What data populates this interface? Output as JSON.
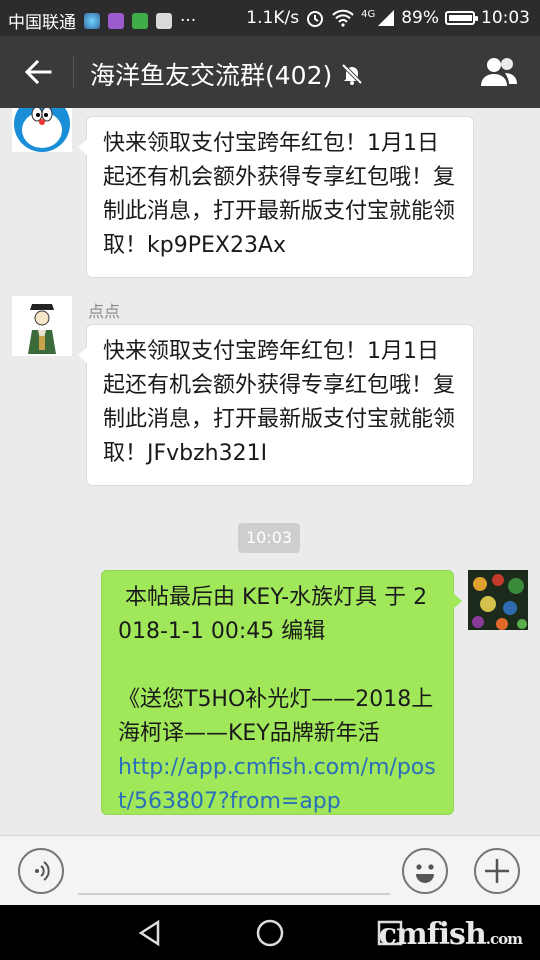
{
  "status_bar": {
    "carrier": "中国联通",
    "dots": "···",
    "net_speed": "1.1K/s",
    "net_type": "4G",
    "battery_pct": "89%",
    "battery_level": 0.89,
    "time": "10:03"
  },
  "header": {
    "title": "海洋鱼友交流群(402)",
    "icons": {
      "back": "back-arrow-icon",
      "mute": "bell-muted-icon",
      "group": "group-members-icon"
    }
  },
  "messages": [
    {
      "side": "left",
      "sender": "",
      "avatar": "doraemon-avatar",
      "text": "快来领取支付宝跨年红包！1月1日起还有机会额外获得专享红包哦！复制此消息，打开最新版支付宝就能领取！kp9PEX23Ax"
    },
    {
      "side": "left",
      "sender": "点点",
      "avatar": "scholar-avatar",
      "text": "快来领取支付宝跨年红包！1月1日起还有机会额外获得专享红包哦！复制此消息，打开最新版支付宝就能领取！JFvbzh321I"
    }
  ],
  "time_divider": "10:03",
  "my_message": {
    "avatar": "aquarium-avatar",
    "line1": " 本帖最后由 KEY-水族灯具 于 2018-1-1 00:45 编辑",
    "line2": "《送您T5HO补光灯——2018上海柯译——KEY品牌新年活",
    "link": "http://app.cmfish.com/m/post/563807?from=app"
  },
  "input_bar": {
    "icons": {
      "voice": "voice-icon",
      "emoji": "emoji-icon",
      "plus": "plus-icon"
    }
  },
  "watermark": {
    "main": "cmfish",
    "suffix": ".com"
  },
  "colors": {
    "my_bubble": "#a0e75a",
    "header_bg": "#3a3a3a",
    "chat_bg": "#ebebeb"
  }
}
